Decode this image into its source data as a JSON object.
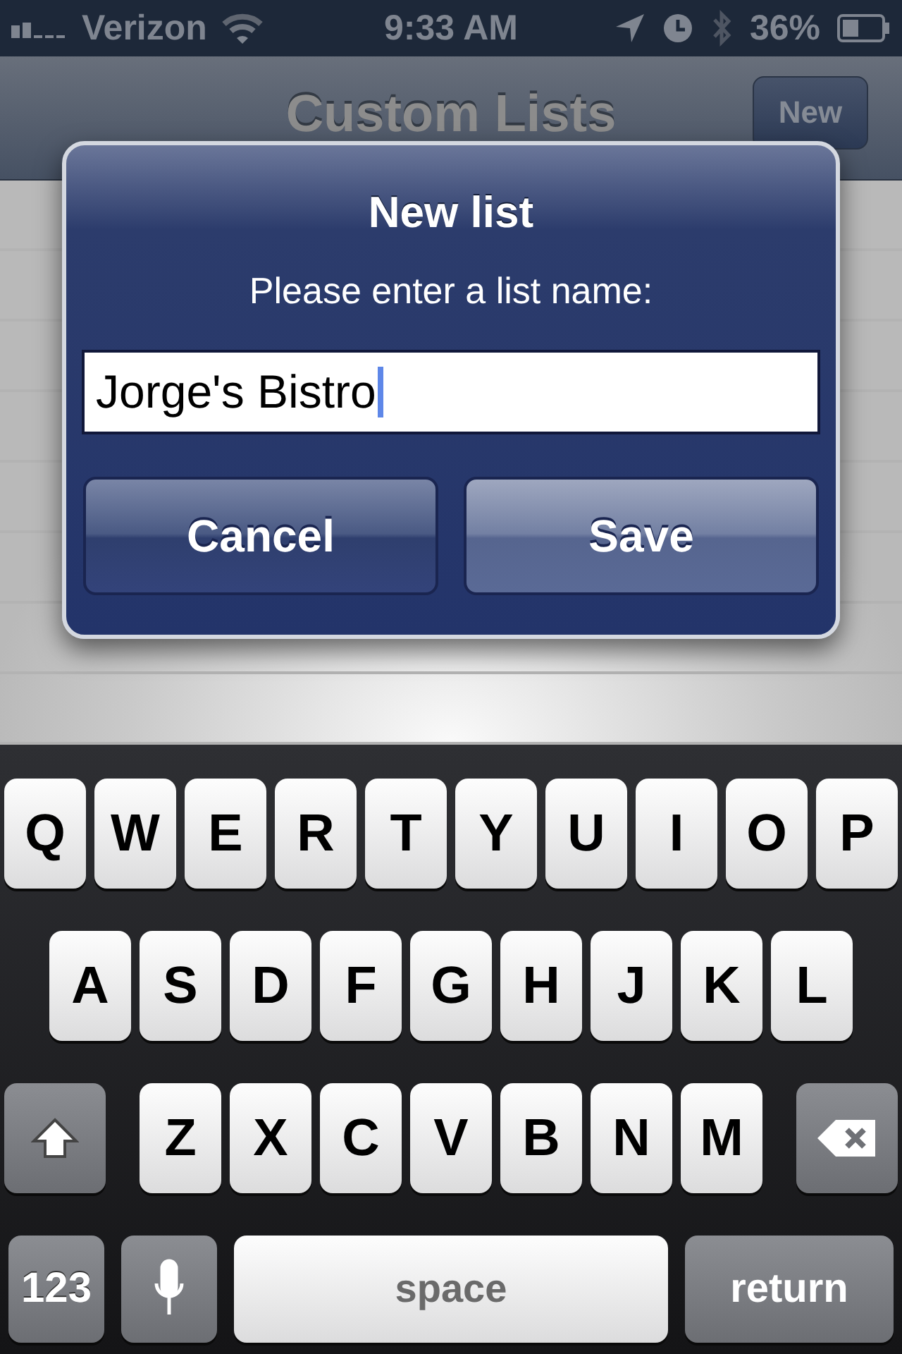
{
  "status_bar": {
    "carrier": "Verizon",
    "time": "9:33 AM",
    "battery": "36%"
  },
  "nav_bar": {
    "title": "Custom Lists",
    "button": "New"
  },
  "dialog": {
    "title": "New list",
    "message": "Please enter a list name:",
    "field_value": "Jorge's Bistro",
    "buttons": [
      {
        "label": "Cancel",
        "kind": "cancel"
      },
      {
        "label": "Save",
        "kind": "default"
      }
    ]
  },
  "keyboard": {
    "rows": [
      {
        "keys": [
          {
            "label": "Q",
            "kind": "letter"
          },
          {
            "label": "W",
            "kind": "letter"
          },
          {
            "label": "E",
            "kind": "letter"
          },
          {
            "label": "R",
            "kind": "letter"
          },
          {
            "label": "T",
            "kind": "letter"
          },
          {
            "label": "Y",
            "kind": "letter"
          },
          {
            "label": "U",
            "kind": "letter"
          },
          {
            "label": "I",
            "kind": "letter"
          },
          {
            "label": "O",
            "kind": "letter"
          },
          {
            "label": "P",
            "kind": "letter"
          }
        ]
      },
      {
        "keys": [
          {
            "label": "A",
            "kind": "letter"
          },
          {
            "label": "S",
            "kind": "letter"
          },
          {
            "label": "D",
            "kind": "letter"
          },
          {
            "label": "F",
            "kind": "letter"
          },
          {
            "label": "G",
            "kind": "letter"
          },
          {
            "label": "H",
            "kind": "letter"
          },
          {
            "label": "J",
            "kind": "letter"
          },
          {
            "label": "K",
            "kind": "letter"
          },
          {
            "label": "L",
            "kind": "letter"
          }
        ]
      },
      {
        "keys": [
          {
            "kind": "shift"
          },
          {
            "label": "Z",
            "kind": "letter"
          },
          {
            "label": "X",
            "kind": "letter"
          },
          {
            "label": "C",
            "kind": "letter"
          },
          {
            "label": "V",
            "kind": "letter"
          },
          {
            "label": "B",
            "kind": "letter"
          },
          {
            "label": "N",
            "kind": "letter"
          },
          {
            "label": "M",
            "kind": "letter"
          },
          {
            "kind": "delete"
          }
        ]
      },
      {
        "keys": [
          {
            "label": "123",
            "kind": "mode"
          },
          {
            "kind": "mic"
          },
          {
            "label": "space",
            "kind": "space"
          },
          {
            "label": "return",
            "kind": "return"
          }
        ]
      }
    ]
  }
}
